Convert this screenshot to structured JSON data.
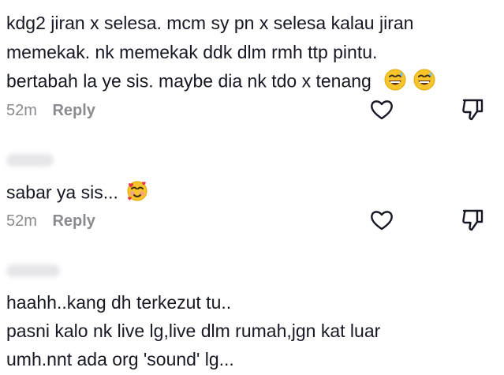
{
  "comments": [
    {
      "lines": [
        "kdg2 jiran x selesa. mcm sy pn x selesa kalau jiran",
        "memekak. nk memekak ddk dlm rmh ttp pintu.",
        "bertabah la ye sis. maybe dia nk tdo x tenang"
      ],
      "emoji": "grinning-sweat-emoji x2",
      "time": "52m",
      "reply_label": "Reply"
    },
    {
      "lines": [
        "sabar ya sis..."
      ],
      "emoji": "smiling-face-with-hearts-emoji",
      "time": "52m",
      "reply_label": "Reply"
    },
    {
      "lines": [
        "haahh..kang dh terkezut tu..",
        "pasni kalo nk live lg,live dlm rumah,jgn kat luar",
        "umh.nnt ada org 'sound' lg..."
      ]
    }
  ],
  "icons": {
    "like": "heart-outline-icon",
    "dislike": "thumbs-down-outline-icon"
  },
  "colors": {
    "text": "#161823",
    "meta": "#8a8b91",
    "icon": "#161823"
  }
}
